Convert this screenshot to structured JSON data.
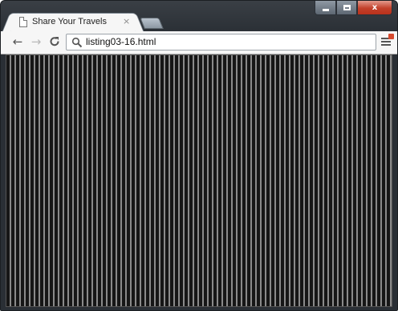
{
  "browser": {
    "tab": {
      "title": "Share Your Travels",
      "close_glyph": "×"
    },
    "window_controls": {
      "minimize_icon": "minimize-icon",
      "maximize_icon": "maximize-icon",
      "close_label": "x"
    },
    "toolbar": {
      "back_glyph": "←",
      "forward_glyph": "→",
      "reload_glyph": "C",
      "url": "listing03-16.html"
    }
  },
  "page": {
    "background": "vertical striped pattern",
    "stripe_colors": [
      "#161616",
      "#8a8a8a"
    ]
  }
}
